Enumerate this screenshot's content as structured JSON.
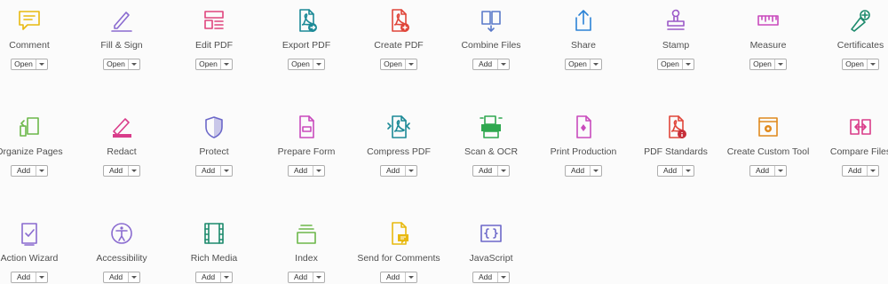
{
  "tools": [
    {
      "name": "Comment",
      "button": "Open",
      "icon": "comment-icon",
      "color": "#e8b90f"
    },
    {
      "name": "Fill & Sign",
      "button": "Open",
      "icon": "fill-sign-icon",
      "color": "#8a6bd0"
    },
    {
      "name": "Edit PDF",
      "button": "Open",
      "icon": "edit-pdf-icon",
      "color": "#e0447d"
    },
    {
      "name": "Export PDF",
      "button": "Open",
      "icon": "export-pdf-icon",
      "color": "#1c8a97"
    },
    {
      "name": "Create PDF",
      "button": "Open",
      "icon": "create-pdf-icon",
      "color": "#e0463a"
    },
    {
      "name": "Combine Files",
      "button": "Add",
      "icon": "combine-files-icon",
      "color": "#5b7ac9"
    },
    {
      "name": "Share",
      "button": "Open",
      "icon": "share-icon",
      "color": "#2c83d6"
    },
    {
      "name": "Stamp",
      "button": "Open",
      "icon": "stamp-icon",
      "color": "#9b59c8"
    },
    {
      "name": "Measure",
      "button": "Open",
      "icon": "measure-icon",
      "color": "#c94bbd"
    },
    {
      "name": "Certificates",
      "button": "Open",
      "icon": "certificates-icon",
      "color": "#1c8a6c"
    },
    {
      "name": "Organize Pages",
      "button": "Add",
      "icon": "organize-pages-icon",
      "color": "#6cb84a"
    },
    {
      "name": "Redact",
      "button": "Add",
      "icon": "redact-icon",
      "color": "#d93c8a"
    },
    {
      "name": "Protect",
      "button": "Add",
      "icon": "protect-icon",
      "color": "#6c68c9"
    },
    {
      "name": "Prepare Form",
      "button": "Add",
      "icon": "prepare-form-icon",
      "color": "#c94bbd"
    },
    {
      "name": "Compress PDF",
      "button": "Add",
      "icon": "compress-pdf-icon",
      "color": "#1c8a97"
    },
    {
      "name": "Scan & OCR",
      "button": "Add",
      "icon": "scan-ocr-icon",
      "color": "#2fa84f"
    },
    {
      "name": "Print Production",
      "button": "Add",
      "icon": "print-production-icon",
      "color": "#c94bbd"
    },
    {
      "name": "PDF Standards",
      "button": "Add",
      "icon": "pdf-standards-icon",
      "color": "#e0463a"
    },
    {
      "name": "Create Custom Tool",
      "button": "Add",
      "icon": "create-custom-tool-icon",
      "color": "#e08a1e"
    },
    {
      "name": "Compare Files",
      "button": "Add",
      "icon": "compare-files-icon",
      "color": "#d93c8a"
    },
    {
      "name": "Action Wizard",
      "button": "Add",
      "icon": "action-wizard-icon",
      "color": "#8a6bd0"
    },
    {
      "name": "Accessibility",
      "button": "Add",
      "icon": "accessibility-icon",
      "color": "#8a6bd0"
    },
    {
      "name": "Rich Media",
      "button": "Add",
      "icon": "rich-media-icon",
      "color": "#1c8a6c"
    },
    {
      "name": "Index",
      "button": "Add",
      "icon": "index-icon",
      "color": "#6cb84a"
    },
    {
      "name": "Send for Comments",
      "button": "Add",
      "icon": "send-for-comments-icon",
      "color": "#e8b90f"
    },
    {
      "name": "JavaScript",
      "button": "Add",
      "icon": "javascript-icon",
      "color": "#6c68c9"
    }
  ]
}
